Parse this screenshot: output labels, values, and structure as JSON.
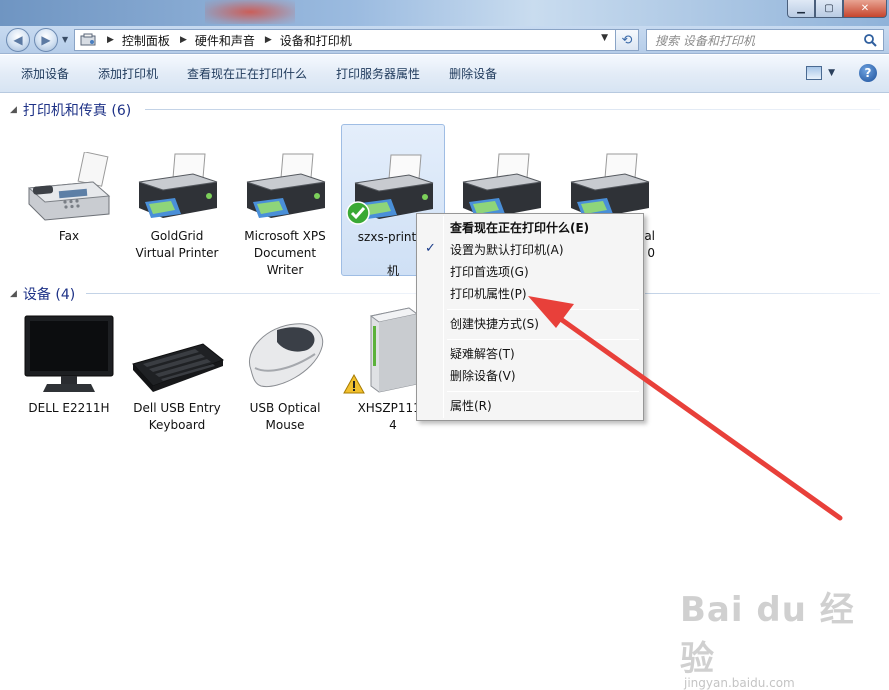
{
  "breadcrumbs": [
    "控制面板",
    "硬件和声音",
    "设备和打印机"
  ],
  "search": {
    "placeholder": "搜索 设备和打印机"
  },
  "toolbar": {
    "add_device": "添加设备",
    "add_printer": "添加打印机",
    "see_printing": "查看现在正在打印什么",
    "print_server_props": "打印服务器属性",
    "remove_device": "删除设备"
  },
  "groups": {
    "printers": {
      "title": "打印机和传真 (6)"
    },
    "devices": {
      "title": "设备 (4)"
    }
  },
  "printers": [
    {
      "line1": "Fax",
      "line2": "",
      "line3": ""
    },
    {
      "line1": "GoldGrid",
      "line2": "Virtual Printer",
      "line3": ""
    },
    {
      "line1": "Microsoft XPS",
      "line2": "Document",
      "line3": "Writer"
    },
    {
      "line1": "szxs-print-0",
      "line2": "",
      "line3": "机"
    },
    {
      "line1": "",
      "line2": "",
      "line3": ""
    },
    {
      "line1": "al",
      "line2": "0",
      "line3": ""
    }
  ],
  "devices": [
    {
      "line1": "DELL E2211H",
      "line2": ""
    },
    {
      "line1": "Dell USB Entry",
      "line2": "Keyboard"
    },
    {
      "line1": "USB Optical",
      "line2": "Mouse"
    },
    {
      "line1": "XHSZP1110",
      "line2": "4"
    }
  ],
  "context_menu": {
    "see_printing": "查看现在正在打印什么(E)",
    "set_default": "设置为默认打印机(A)",
    "preferences": "打印首选项(G)",
    "printer_props": "打印机属性(P)",
    "create_shortcut": "创建快捷方式(S)",
    "troubleshoot": "疑难解答(T)",
    "remove": "删除设备(V)",
    "properties": "属性(R)"
  },
  "watermark": {
    "brand": "Bai du 经验",
    "url": "jingyan.baidu.com"
  },
  "colors": {
    "arrow": "#e8403a",
    "group_header": "#1e3287",
    "selection": "#cfe0f5"
  }
}
